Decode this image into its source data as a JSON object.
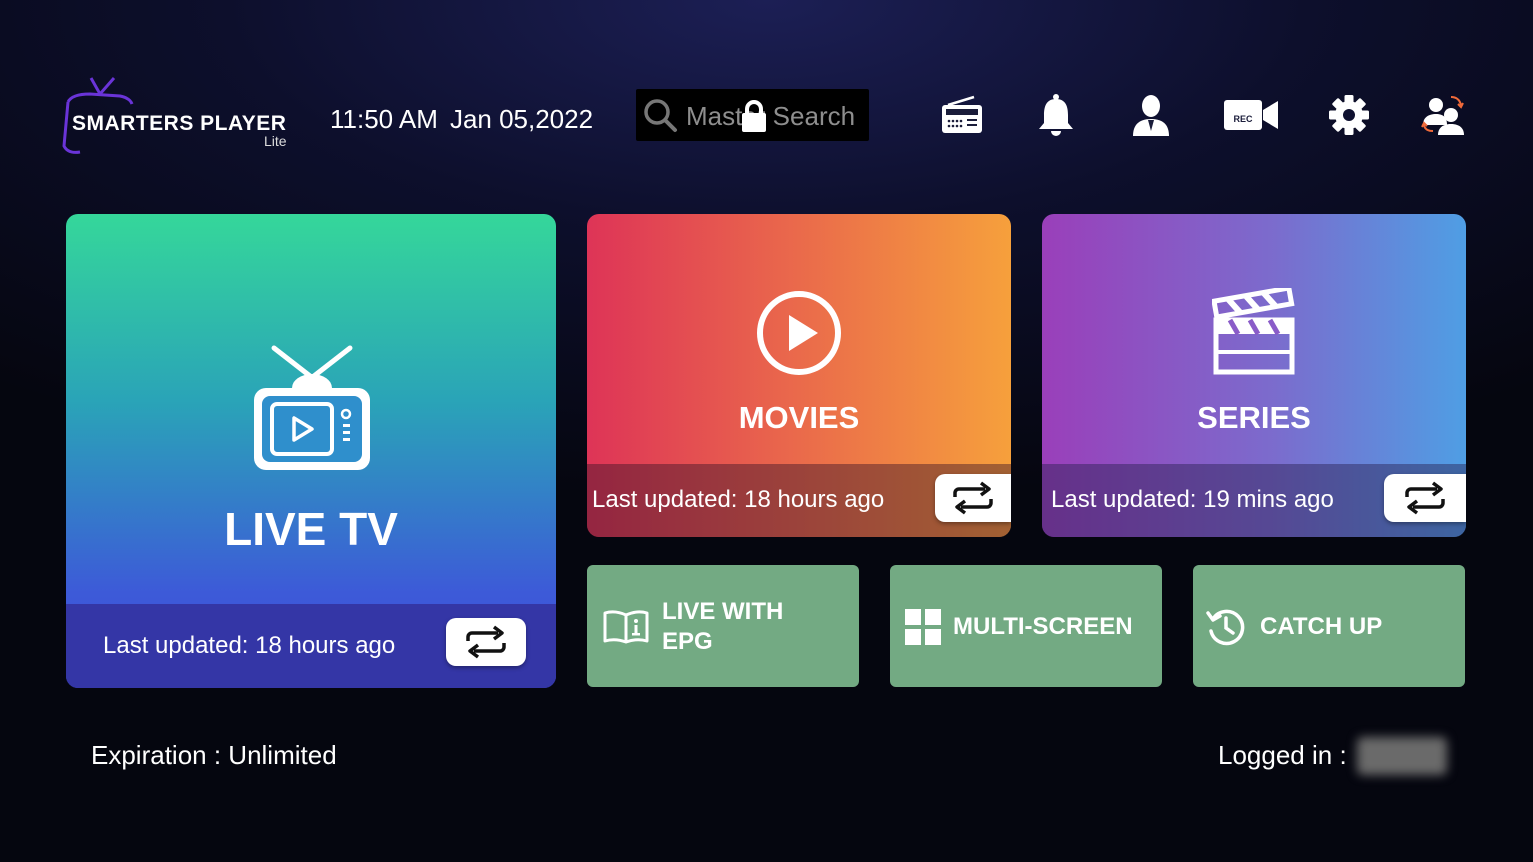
{
  "app": {
    "logo_text": "SMARTERS PLAYER",
    "logo_sub": "Lite"
  },
  "header": {
    "time": "11:50 AM",
    "date": "Jan 05,2022",
    "search": {
      "placeholder": "Master Search"
    },
    "icons": [
      "radio-icon",
      "bell-icon",
      "user-icon",
      "rec-camera-icon",
      "gear-icon",
      "switch-user-icon"
    ],
    "rec_label": "REC"
  },
  "tiles": {
    "live_tv": {
      "title": "LIVE TV",
      "updated": "Last updated: 18 hours ago"
    },
    "movies": {
      "title": "MOVIES",
      "updated": "Last updated: 18 hours ago"
    },
    "series": {
      "title": "SERIES",
      "updated": "Last updated: 19 mins ago"
    }
  },
  "shortcuts": {
    "epg": {
      "line1": "LIVE WITH",
      "line2": "EPG"
    },
    "multi": {
      "label": "MULTI-SCREEN"
    },
    "catchup": {
      "label": "CATCH UP"
    }
  },
  "footer": {
    "expiration": "Expiration : Unlimited",
    "logged_in": "Logged in :"
  },
  "colors": {
    "shortcut_bg": "#73aa83",
    "live_gradient": [
      "#35d79a",
      "#3f4de0"
    ],
    "movies_gradient": [
      "#de3457",
      "#f6a03c"
    ],
    "series_gradient": [
      "#9a3fba",
      "#4f9ee4"
    ]
  }
}
